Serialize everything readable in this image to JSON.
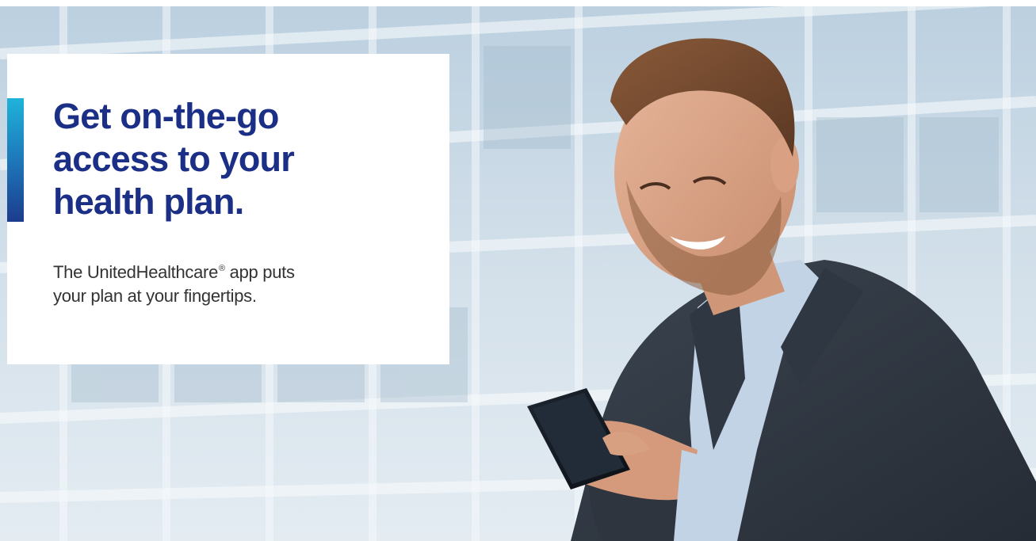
{
  "hero": {
    "headline_lines": [
      "Get on-the-go",
      "access to your",
      "health plan."
    ],
    "subtext": {
      "line1_before": "The UnitedHealthcare",
      "registered_mark": "®",
      "line1_after": " app puts",
      "line2": "your plan at your fingertips."
    },
    "photo": {
      "subject": "man-smiling-using-smartphone",
      "setting": "glass-office-building-background"
    }
  },
  "colors": {
    "headline": "#1b2f86",
    "body_text": "#333333",
    "accent_top": "#1fb3da",
    "accent_bottom": "#1b3c8c",
    "card_background": "#ffffff"
  }
}
